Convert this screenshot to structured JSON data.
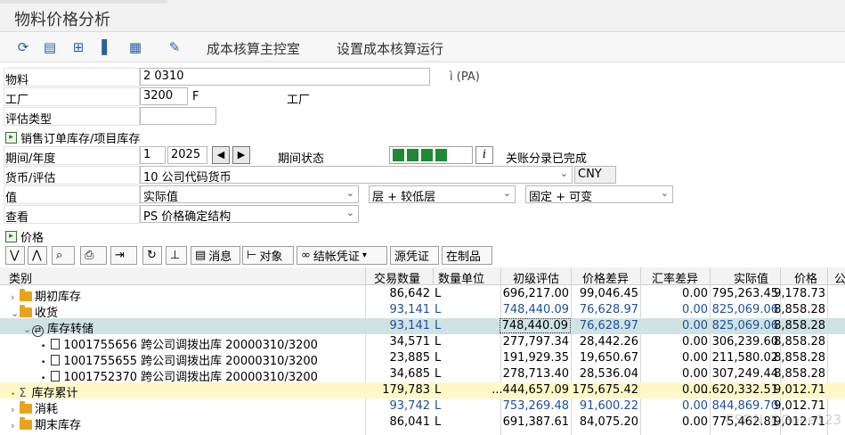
{
  "window": {
    "title": "物料价格分析"
  },
  "toolbar": {
    "link1": "成本核算主控室",
    "link2": "设置成本核算运行"
  },
  "form": {
    "material_label": "物料",
    "material_value": "2 0310",
    "material_desc": "ì       (PA)",
    "plant_label": "工厂",
    "plant_value": "3200",
    "plant_desc1": "F",
    "plant_desc2": "工厂",
    "valtype_label": "评估类型",
    "valtype_value": "",
    "so_stock_label": "销售订单库存/项目库存",
    "period_label": "期间/年度",
    "period_value": "1",
    "year_value": "2025",
    "period_status_label": "期间状态",
    "period_status_text": "关账分录已完成",
    "currency_label": "货币/评估",
    "currency_value": "10 公司代码货币",
    "currency_code": "CNY",
    "value_label": "值",
    "value_sel": "实际值",
    "layer_sel": "层 + 较低层",
    "fixvar_sel": "固定 + 可变",
    "view_label": "查看",
    "view_sel": "PS 价格确定结构",
    "price_section": "价格"
  },
  "grid_toolbar": {
    "msg": "消息",
    "obj": "对象",
    "settle": "结帐凭证",
    "src": "源凭证",
    "wip": "在制品"
  },
  "grid": {
    "headers": [
      "类别",
      "交易数量",
      "数量单位",
      "初级评估",
      "价格差异",
      "汇率差异",
      "实际值",
      "价格",
      "公"
    ],
    "rows": [
      {
        "cat": "期初库存",
        "qty": "86,642",
        "unit": "L",
        "primary": "696,217.00",
        "pdiff": "99,046.45",
        "xdiff": "0.00",
        "actual": "795,263.45",
        "price": "9,178.73"
      },
      {
        "cat": "收货",
        "qty": "93,141",
        "unit": "L",
        "primary": "748,440.09",
        "pdiff": "76,628.97",
        "xdiff": "0.00",
        "actual": "825,069.06",
        "price": "8,858.28"
      },
      {
        "cat": "库存转储",
        "qty": "93,141",
        "unit": "L",
        "primary": "748,440.09",
        "pdiff": "76,628.97",
        "xdiff": "0.00",
        "actual": "825,069.06",
        "price": "8,858.28"
      },
      {
        "cat": "1001755656 跨公司调拨出库 20000310/3200",
        "qty": "34,571",
        "unit": "L",
        "primary": "277,797.34",
        "pdiff": "28,442.26",
        "xdiff": "0.00",
        "actual": "306,239.60",
        "price": "8,858.28"
      },
      {
        "cat": "1001755655 跨公司调拨出库 20000310/3200",
        "qty": "23,885",
        "unit": "L",
        "primary": "191,929.35",
        "pdiff": "19,650.67",
        "xdiff": "0.00",
        "actual": "211,580.02",
        "price": "8,858.28"
      },
      {
        "cat": "1001752370 跨公司调拨出库 20000310/3200",
        "qty": "34,685",
        "unit": "L",
        "primary": "278,713.40",
        "pdiff": "28,536.04",
        "xdiff": "0.00",
        "actual": "307,249.44",
        "price": "8,858.28"
      },
      {
        "cat": "库存累计",
        "qty": "179,783",
        "unit": "L",
        "primary": "...444,657.09",
        "pdiff": "175,675.42",
        "xdiff": "0.00",
        "actual": "...620,332.51",
        "price": "9,012.71"
      },
      {
        "cat": "消耗",
        "qty": "93,742",
        "unit": "L",
        "primary": "753,269.48",
        "pdiff": "91,600.22",
        "xdiff": "0.00",
        "actual": "844,869.70",
        "price": "9,012.71"
      },
      {
        "cat": "期末库存",
        "qty": "86,041",
        "unit": "L",
        "primary": "691,387.61",
        "pdiff": "84,075.20",
        "xdiff": "0.00",
        "actual": "775,462.81",
        "price": "9,012.71"
      }
    ]
  },
  "watermark": "CSDN @Gone123",
  "colors": {
    "green": "#1e8a34",
    "blue_text": "#1e4e9e",
    "highlight": "#cfe3e3",
    "total": "#fff8c6"
  }
}
